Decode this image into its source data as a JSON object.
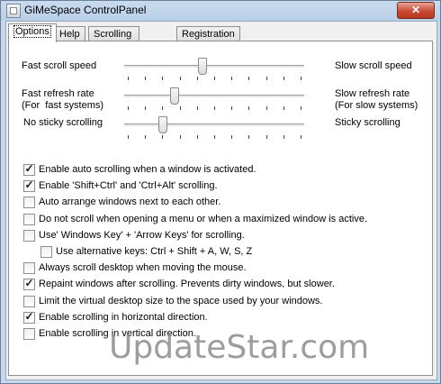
{
  "window": {
    "title": "GiMeSpace ControlPanel",
    "close_glyph": "✕"
  },
  "tabs": [
    {
      "label": "Options",
      "active": true
    },
    {
      "label": "Help",
      "active": false
    },
    {
      "label": "Scrolling Windows",
      "active": false
    },
    {
      "label": "Registration",
      "active": false
    }
  ],
  "sliders": [
    {
      "left_label": "Fast scroll speed",
      "right_label": "Slow scroll speed",
      "value_fraction": 0.43
    },
    {
      "left_label": "Fast refresh rate\n(For  fast systems)",
      "right_label": "Slow refresh rate\n(For slow systems)",
      "value_fraction": 0.27
    },
    {
      "left_label": "No sticky scrolling",
      "right_label": "Sticky scrolling",
      "value_fraction": 0.2
    }
  ],
  "slider_tick_count": 11,
  "options": [
    {
      "label": "Enable auto scrolling when a window is activated.",
      "checked": true
    },
    {
      "label": "Enable 'Shift+Ctrl' and 'Ctrl+Alt' scrolling.",
      "checked": true
    },
    {
      "label": "Auto arrange windows next to each other.",
      "checked": false
    },
    {
      "label": "Do not scroll when opening a menu or when a maximized window is active.",
      "checked": false
    },
    {
      "label": "Use' Windows Key' + 'Arrow Keys' for scrolling.",
      "checked": false
    },
    {
      "label": "Use alternative keys: Ctrl + Shift + A, W, S, Z",
      "checked": false,
      "indent": true
    },
    {
      "label": "Always scroll desktop when moving the mouse.",
      "checked": false
    },
    {
      "label": "Repaint windows after scrolling. Prevents dirty windows, but slower.",
      "checked": true
    },
    {
      "label": "Limit the virtual desktop size to the space used by your windows.",
      "checked": false
    },
    {
      "label": "Enable scrolling in horizontal direction.",
      "checked": true
    },
    {
      "label": "Enable scrolling in vertical direction.",
      "checked": false
    }
  ],
  "check_glyph": "✓",
  "watermark": "UpdateStar.com"
}
